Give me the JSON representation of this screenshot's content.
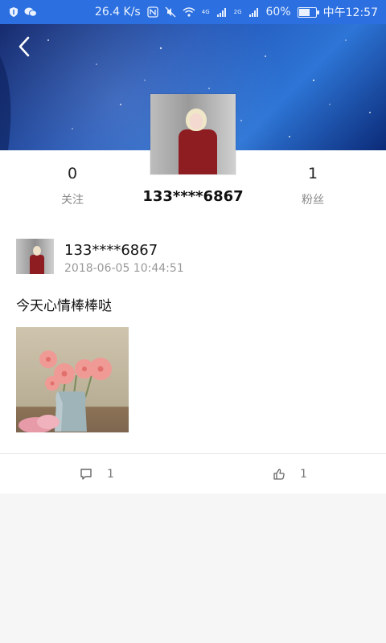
{
  "status_bar": {
    "speed": "26.4 K/s",
    "network_4g": "4G",
    "network_2g": "2G",
    "battery": "60%",
    "time": "中午12:57"
  },
  "header": {
    "back_icon": "chevron-left-icon"
  },
  "profile": {
    "following_count": "0",
    "following_label": "关注",
    "followers_count": "1",
    "followers_label": "粉丝",
    "username": "133****6867"
  },
  "post": {
    "username": "133****6867",
    "timestamp": "2018-06-05 10:44:51",
    "text": "今天心情棒棒哒",
    "comment_count": "1",
    "like_count": "1",
    "comment_icon": "comment-icon",
    "like_icon": "thumbs-up-icon"
  },
  "colors": {
    "status_bar": "#2b6fe0",
    "banner_dark": "#10256a",
    "banner_light": "#2d75d6",
    "coat_red": "#8e1d22"
  }
}
